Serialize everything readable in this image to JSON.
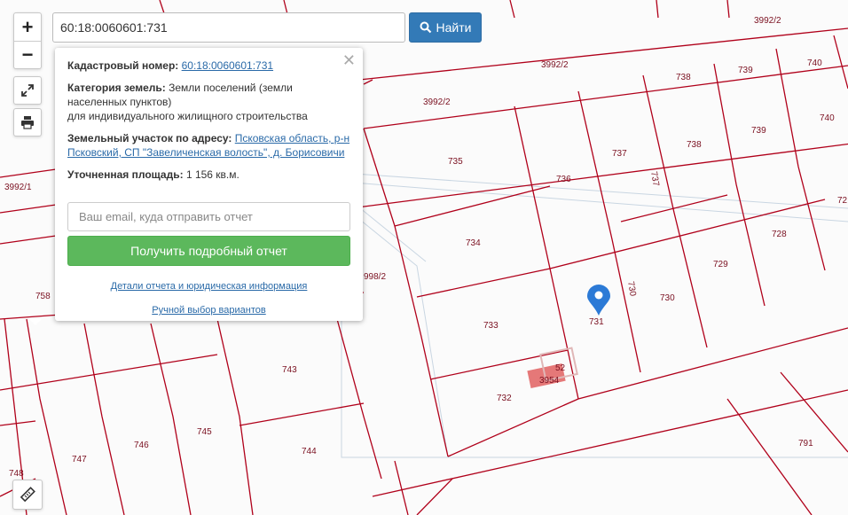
{
  "controls": {
    "zoom_in": "+",
    "zoom_out": "−",
    "fullscreen_icon": "expand-arrows",
    "print_icon": "printer",
    "ruler_icon": "ruler"
  },
  "search": {
    "value": "60:18:0060601:731",
    "button_label": "Найти"
  },
  "popup": {
    "cadastral_label": "Кадастровый номер:",
    "cadastral_number": "60:18:0060601:731",
    "category_label": "Категория земель:",
    "category_value": "Земли поселений (земли населенных пунктов)",
    "purpose": "для индивидуального жилищного строительства",
    "address_label": "Земельный участок по адресу:",
    "address_value": "Псковская область, р-н Псковский, СП \"Завеличенская волость\", д. Борисовичи",
    "area_label": "Уточненная площадь:",
    "area_value": "1 156 кв.м.",
    "email_placeholder": "Ваш email, куда отправить отчет",
    "report_button": "Получить подробный отчет",
    "details_link": "Детали отчета и юридическая информация",
    "manual_link": "Ручной выбор вариантов"
  },
  "map": {
    "parcel_labels": [
      "3992/2",
      "3992/2",
      "3992/2",
      "3992/1",
      "739",
      "740",
      "740",
      "738",
      "738",
      "739",
      "737",
      "737",
      "736",
      "735",
      "734",
      "728",
      "729",
      "730",
      "730",
      "731",
      "733",
      "732",
      "3954",
      "52",
      "743",
      "744",
      "745",
      "746",
      "747",
      "748",
      "758",
      "791",
      "998/2",
      "72"
    ],
    "line_color": "#b0001a",
    "marker_color": "#2c7ad6"
  }
}
